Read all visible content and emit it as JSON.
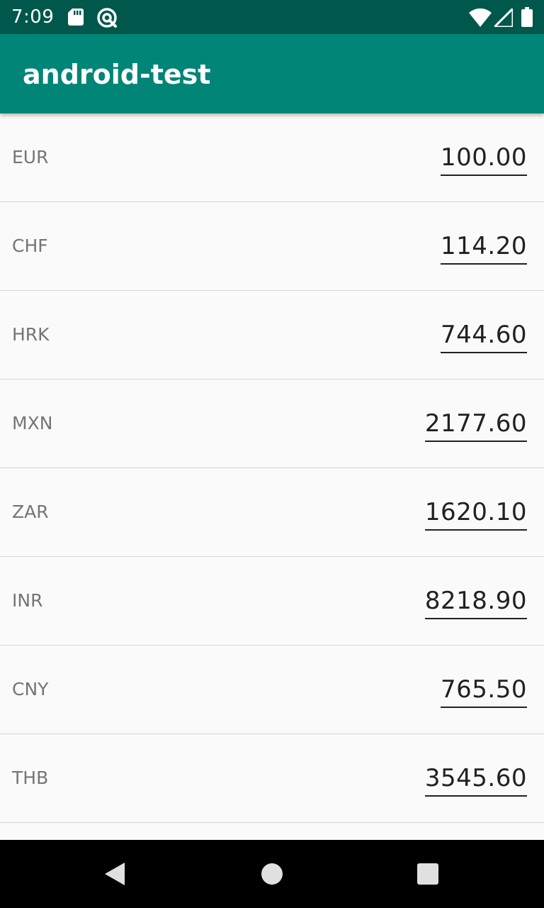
{
  "status_bar": {
    "time": "7:09",
    "left_icons": [
      "sd-card-icon",
      "vpn-icon"
    ],
    "right_icons": [
      "wifi-icon",
      "signal-icon",
      "battery-icon"
    ]
  },
  "app_bar": {
    "title": "android-test",
    "color": "#008577"
  },
  "currencies": [
    {
      "code": "EUR",
      "amount": "100.00"
    },
    {
      "code": "CHF",
      "amount": "114.20"
    },
    {
      "code": "HRK",
      "amount": "744.60"
    },
    {
      "code": "MXN",
      "amount": "2177.60"
    },
    {
      "code": "ZAR",
      "amount": "1620.10"
    },
    {
      "code": "INR",
      "amount": "8218.90"
    },
    {
      "code": "CNY",
      "amount": "765.50"
    },
    {
      "code": "THB",
      "amount": "3545.60"
    }
  ],
  "nav_bar": {
    "buttons": [
      "back-icon",
      "home-icon",
      "recents-icon"
    ]
  }
}
